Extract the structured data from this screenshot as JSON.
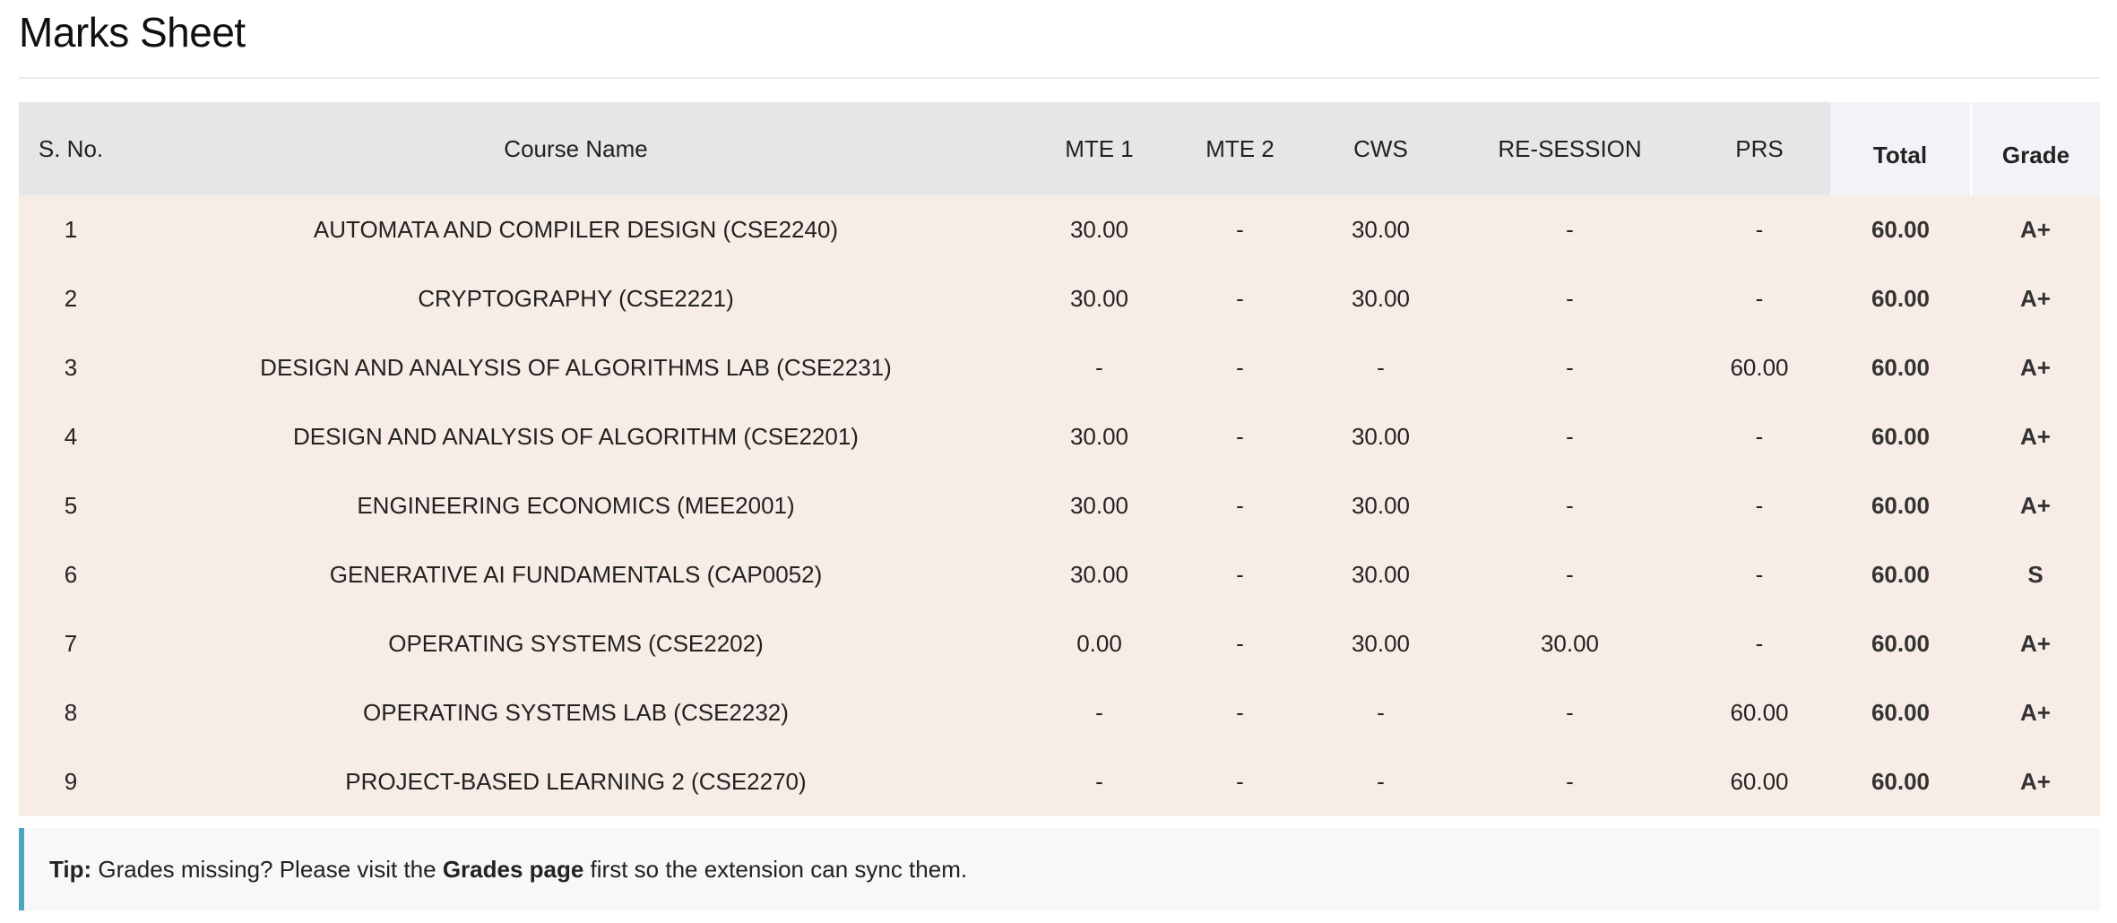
{
  "page": {
    "title": "Marks Sheet"
  },
  "table": {
    "headers": [
      "S. No.",
      "Course Name",
      "MTE 1",
      "MTE 2",
      "CWS",
      "RE-SESSION",
      "PRS",
      "Total",
      "Grade"
    ],
    "rows": [
      [
        "1",
        "AUTOMATA AND COMPILER DESIGN (CSE2240)",
        "30.00",
        "-",
        "30.00",
        "-",
        "-",
        "60.00",
        "A+"
      ],
      [
        "2",
        "CRYPTOGRAPHY (CSE2221)",
        "30.00",
        "-",
        "30.00",
        "-",
        "-",
        "60.00",
        "A+"
      ],
      [
        "3",
        "DESIGN AND ANALYSIS OF ALGORITHMS LAB (CSE2231)",
        "-",
        "-",
        "-",
        "-",
        "60.00",
        "60.00",
        "A+"
      ],
      [
        "4",
        "DESIGN AND ANALYSIS OF ALGORITHM (CSE2201)",
        "30.00",
        "-",
        "30.00",
        "-",
        "-",
        "60.00",
        "A+"
      ],
      [
        "5",
        "ENGINEERING ECONOMICS (MEE2001)",
        "30.00",
        "-",
        "30.00",
        "-",
        "-",
        "60.00",
        "A+"
      ],
      [
        "6",
        "GENERATIVE AI FUNDAMENTALS (CAP0052)",
        "30.00",
        "-",
        "30.00",
        "-",
        "-",
        "60.00",
        "S"
      ],
      [
        "7",
        "OPERATING SYSTEMS (CSE2202)",
        "0.00",
        "-",
        "30.00",
        "30.00",
        "-",
        "60.00",
        "A+"
      ],
      [
        "8",
        "OPERATING SYSTEMS LAB (CSE2232)",
        "-",
        "-",
        "-",
        "-",
        "60.00",
        "60.00",
        "A+"
      ],
      [
        "9",
        "PROJECT-BASED LEARNING 2 (CSE2270)",
        "-",
        "-",
        "-",
        "-",
        "60.00",
        "60.00",
        "A+"
      ]
    ]
  },
  "tip": {
    "label": "Tip:",
    "text_before": " Grades missing? Please visit the ",
    "link_text": "Grades page",
    "text_after": " first so the extension can sync them."
  },
  "colors": {
    "header_bg": "#e6e6e9",
    "emphasized_header_bg": "#f2f3f6",
    "row_bg": "#f8ede6",
    "tip_bg": "#f7f8fa",
    "tip_accent": "#4aa6b8"
  }
}
